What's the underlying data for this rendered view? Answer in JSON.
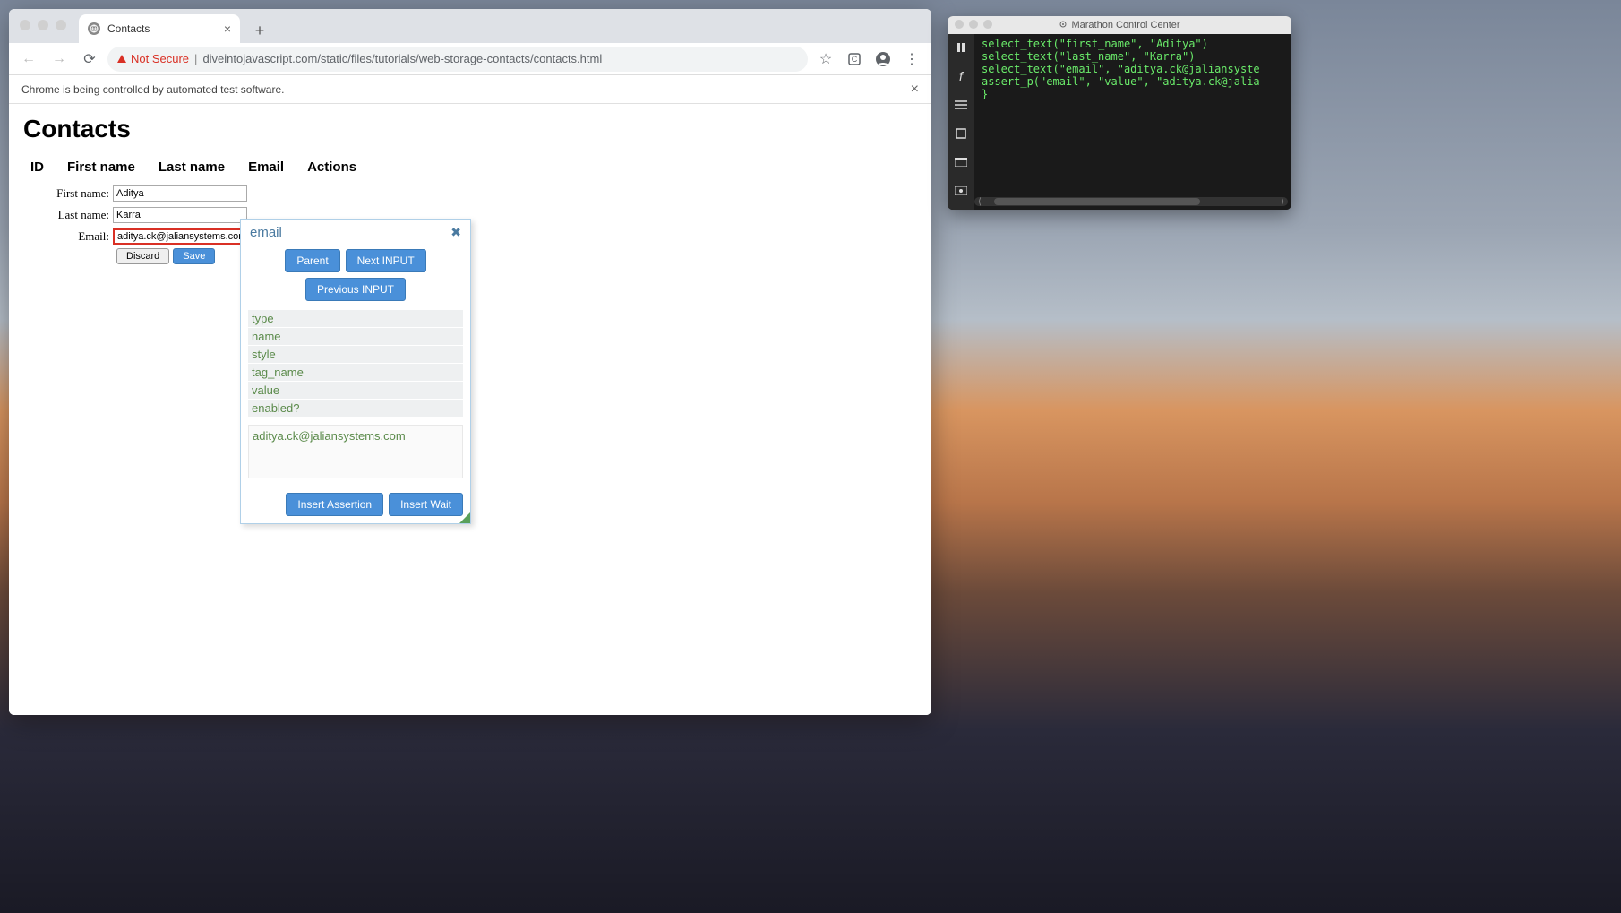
{
  "browser": {
    "tab_title": "Contacts",
    "not_secure_label": "Not Secure",
    "url": "diveintojavascript.com/static/files/tutorials/web-storage-contacts/contacts.html",
    "automation_message": "Chrome is being controlled by automated test software."
  },
  "page": {
    "title": "Contacts",
    "table_headers": [
      "ID",
      "First name",
      "Last name",
      "Email",
      "Actions"
    ],
    "form": {
      "first_name_label": "First name:",
      "first_name_value": "Aditya",
      "last_name_label": "Last name:",
      "last_name_value": "Karra",
      "email_label": "Email:",
      "email_value": "aditya.ck@jaliansystems.com",
      "discard_label": "Discard",
      "save_label": "Save"
    }
  },
  "inspector": {
    "title": "email",
    "btn_parent": "Parent",
    "btn_next": "Next INPUT",
    "btn_prev": "Previous INPUT",
    "props": [
      "type",
      "name",
      "style",
      "tag_name",
      "value",
      "enabled?"
    ],
    "value_display": "aditya.ck@jaliansystems.com",
    "btn_insert_assertion": "Insert Assertion",
    "btn_insert_wait": "Insert Wait"
  },
  "marathon": {
    "title": "Marathon Control Center",
    "code_lines": [
      "select_text(\"first_name\", \"Aditya\")",
      "select_text(\"last_name\", \"Karra\")",
      "select_text(\"email\", \"aditya.ck@jaliansyste",
      "assert_p(\"email\", \"value\", \"aditya.ck@jalia",
      "}"
    ]
  }
}
